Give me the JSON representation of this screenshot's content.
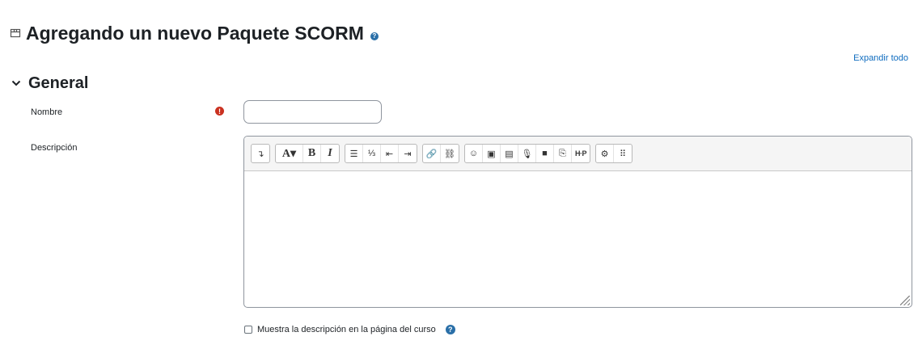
{
  "page": {
    "title": "Agregando un nuevo Paquete SCORM",
    "title_icon": "package-icon",
    "help_glyph": "?"
  },
  "expand_all_label": "Expandir todo",
  "section": {
    "title": "General",
    "chevron": "⌄"
  },
  "fields": {
    "name_label": "Nombre",
    "name_value": "",
    "required_glyph": "!",
    "description_label": "Descripción"
  },
  "editor": {
    "toolbar_groups": [
      [
        {
          "name": "show-more-icon",
          "glyph": "↴"
        }
      ],
      [
        {
          "name": "font-style-dropdown",
          "glyph": "A▾"
        },
        {
          "name": "bold-button",
          "glyph": "B"
        },
        {
          "name": "italic-button",
          "glyph": "I"
        }
      ],
      [
        {
          "name": "unordered-list-icon",
          "glyph": "☰"
        },
        {
          "name": "ordered-list-icon",
          "glyph": "⅓"
        },
        {
          "name": "outdent-icon",
          "glyph": "⇤"
        },
        {
          "name": "indent-icon",
          "glyph": "⇥"
        }
      ],
      [
        {
          "name": "link-icon",
          "glyph": "🔗"
        },
        {
          "name": "unlink-icon",
          "glyph": "⛓"
        }
      ],
      [
        {
          "name": "emoji-icon",
          "glyph": "☺"
        },
        {
          "name": "image-icon",
          "glyph": "▣"
        },
        {
          "name": "media-icon",
          "glyph": "▤"
        },
        {
          "name": "record-audio-icon",
          "glyph": "🎙"
        },
        {
          "name": "record-video-icon",
          "glyph": "■"
        },
        {
          "name": "manage-files-icon",
          "glyph": "⎘"
        },
        {
          "name": "h5p-icon",
          "glyph": "H·P"
        }
      ],
      [
        {
          "name": "accessibility-checker-icon",
          "glyph": "⚙"
        },
        {
          "name": "screenreader-helper-icon",
          "glyph": "⠿"
        }
      ]
    ]
  },
  "show_description": {
    "label": "Muestra la descripción en la página del curso",
    "checked": false
  },
  "colors": {
    "link": "#0f6cbf",
    "required": "#ca3120",
    "help": "#2a6fa8"
  }
}
